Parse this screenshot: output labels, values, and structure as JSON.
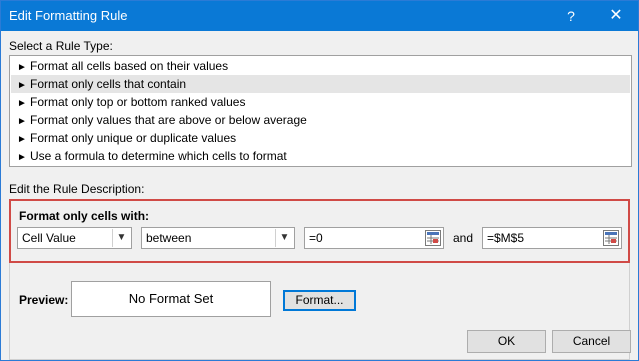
{
  "window": {
    "title": "Edit Formatting Rule",
    "help_label": "?",
    "close_label": "✕"
  },
  "rule_type": {
    "label": "Select a Rule Type:",
    "items": [
      {
        "label": "Format all cells based on their values"
      },
      {
        "label": "Format only cells that contain"
      },
      {
        "label": "Format only top or bottom ranked values"
      },
      {
        "label": "Format only values that are above or below average"
      },
      {
        "label": "Format only unique or duplicate values"
      },
      {
        "label": "Use a formula to determine which cells to format"
      }
    ],
    "selected_index": 1
  },
  "rule_description": {
    "label": "Edit the Rule Description:",
    "heading": "Format only cells with:",
    "condition_select": {
      "value": "Cell Value"
    },
    "operator_select": {
      "value": "between"
    },
    "value1": "=0",
    "and_label": "and",
    "value2": "=$M$5"
  },
  "preview": {
    "label": "Preview:",
    "text": "No Format Set"
  },
  "buttons": {
    "format": "Format...",
    "ok": "OK",
    "cancel": "Cancel"
  },
  "colors": {
    "titlebar": "#0a79d6",
    "highlight_border": "#d04a46",
    "selected_row": "#e5e5e5"
  }
}
